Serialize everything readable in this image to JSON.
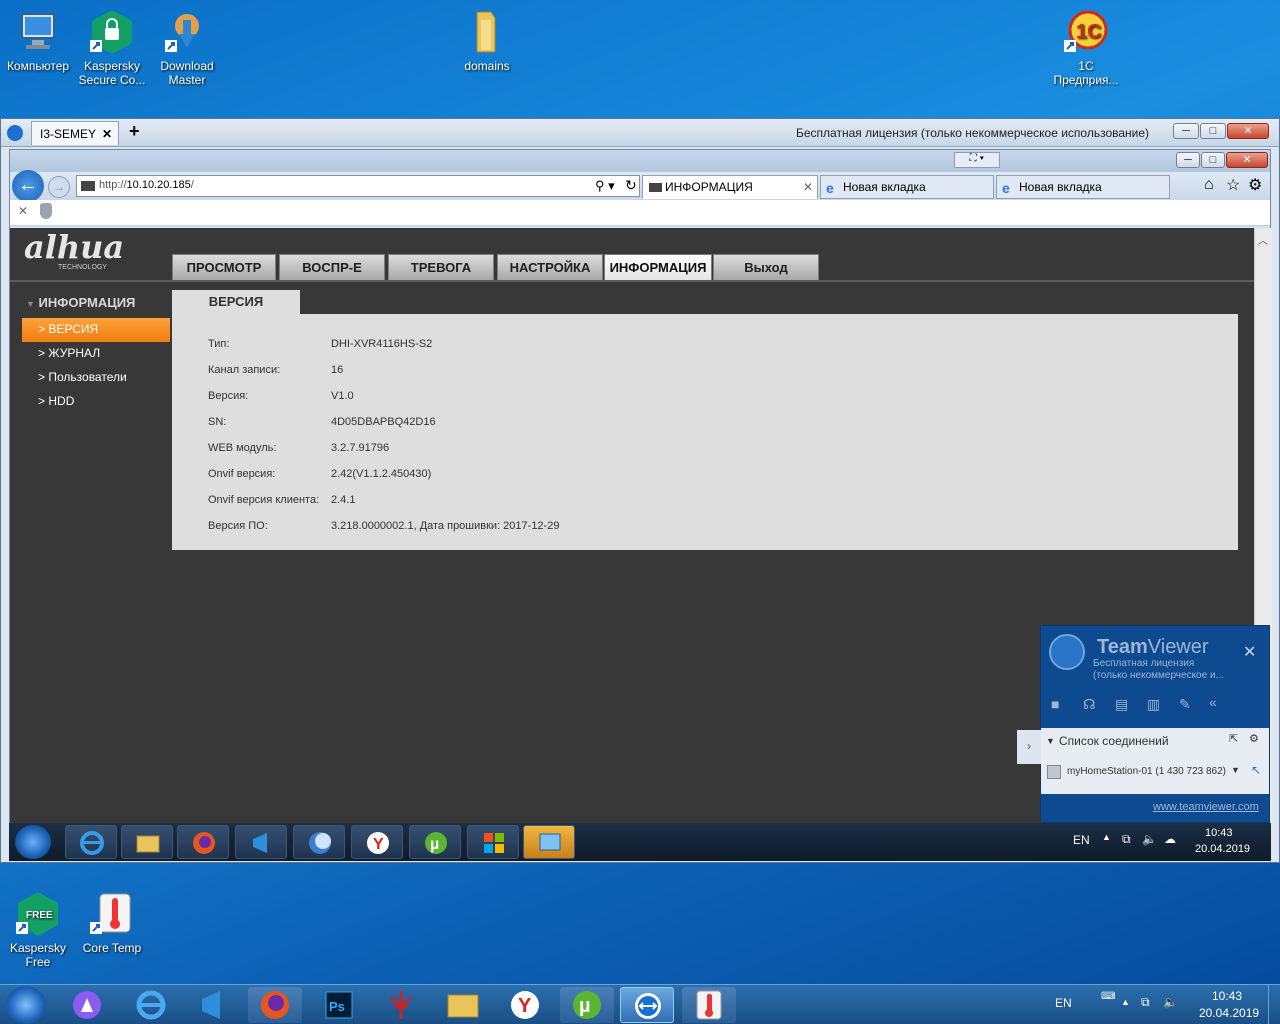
{
  "desktop": {
    "icons_top": [
      {
        "label": "Компьютер"
      },
      {
        "label": "Kaspersky Secure Co..."
      },
      {
        "label": "Download Master"
      },
      {
        "label": "domains"
      },
      {
        "label": "1С Предприя..."
      }
    ],
    "icons_bottom": [
      {
        "label": "Kaspersky Free"
      },
      {
        "label": "Core Temp"
      }
    ]
  },
  "teamviewer_window": {
    "tab_label": "I3-SEMEY",
    "license_text": "Бесплатная лицензия (только некоммерческое использование)"
  },
  "browser": {
    "url_prefix": "http://",
    "url_host": "10.10.20.185",
    "url_suffix": "/",
    "tabs": [
      {
        "label": "ИНФОРМАЦИЯ",
        "active": true
      },
      {
        "label": "Новая вкладка",
        "active": false
      },
      {
        "label": "Новая вкладка",
        "active": false
      }
    ]
  },
  "dahua": {
    "logo": "alhua",
    "logo_sub": "TECHNOLOGY",
    "nav": [
      "ПРОСМОТР",
      "ВОСПР-Е",
      "ТРЕВОГА",
      "НАСТРОЙКА",
      "ИНФОРМАЦИЯ",
      "Выход"
    ],
    "active_nav": "ИНФОРМАЦИЯ",
    "sidebar_title": "ИНФОРМАЦИЯ",
    "sidebar_items": [
      "ВЕРСИЯ",
      "ЖУРНАЛ",
      "Пользователи",
      "HDD"
    ],
    "panel_tab": "ВЕРСИЯ",
    "info": [
      {
        "key": "Тип:",
        "value": "DHI-XVR4116HS-S2"
      },
      {
        "key": "Канал записи:",
        "value": "16"
      },
      {
        "key": "Версия:",
        "value": "V1.0"
      },
      {
        "key": "SN:",
        "value": "4D05DBAPBQ42D16"
      },
      {
        "key": "WEB модуль:",
        "value": "3.2.7.91796"
      },
      {
        "key": "Onvif версия:",
        "value": "2.42(V1.1.2.450430)"
      },
      {
        "key": "Onvif версия клиента:",
        "value": "2.4.1"
      },
      {
        "key": "Версия ПО:",
        "value": "3.218.0000002.1, Дата прошивки: 2017-12-29"
      }
    ]
  },
  "tv_panel": {
    "brand_a": "Team",
    "brand_b": "Viewer",
    "license_line1": "Бесплатная лицензия",
    "license_line2": "(только некоммерческое и...",
    "connections_title": "Список соединений",
    "connection_item": "myHomeStation-01 (1 430 723 862)",
    "link": "www.teamviewer.com"
  },
  "remote_taskbar": {
    "lang": "EN",
    "time": "10:43",
    "date": "20.04.2019"
  },
  "taskbar": {
    "lang": "EN",
    "time": "10:43",
    "date": "20.04.2019"
  },
  "colors": {
    "accent_orange": "#f08a1c",
    "dahua_bg": "#383838",
    "panel_bg": "#dedede",
    "tv_blue": "#0d4a8f"
  }
}
